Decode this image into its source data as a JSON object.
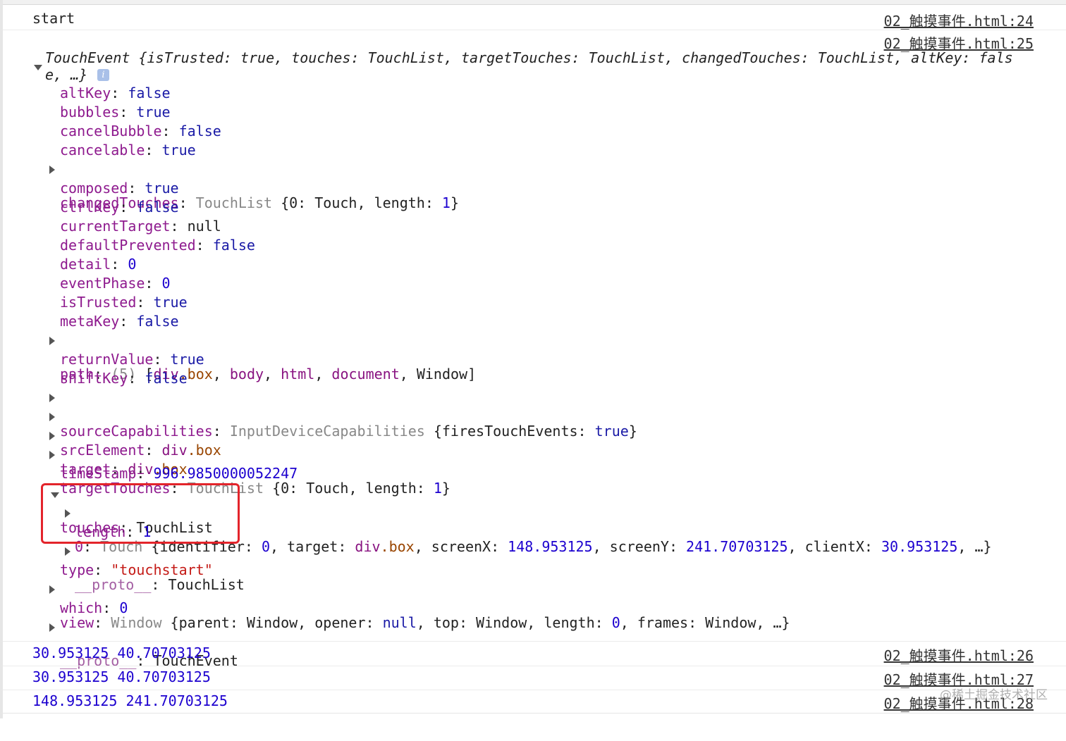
{
  "console": {
    "row_start": {
      "text": "start",
      "src": "02_触摸事件.html:24"
    },
    "event": {
      "src": "02_触摸事件.html:25",
      "summary_line1": "TouchEvent {isTrusted: true, touches: TouchList, targetTouches: TouchList, changedTouches: TouchList, altKey: fals",
      "summary_line2": "e, …}",
      "info_icon": "i",
      "props": {
        "altKey": {
          "key": "altKey",
          "val": "false"
        },
        "bubbles": {
          "key": "bubbles",
          "val": "true"
        },
        "cancelBubble": {
          "key": "cancelBubble",
          "val": "false"
        },
        "cancelable": {
          "key": "cancelable",
          "val": "true"
        },
        "changedTouches": {
          "key": "changedTouches",
          "type": "TouchList",
          "open": "{0: ",
          "mid": "Touch",
          "len_label": ", length: ",
          "len": "1",
          "close": "}"
        },
        "composed": {
          "key": "composed",
          "val": "true"
        },
        "ctrlKey": {
          "key": "ctrlKey",
          "val": "false"
        },
        "currentTarget": {
          "key": "currentTarget",
          "val": "null"
        },
        "defaultPrevented": {
          "key": "defaultPrevented",
          "val": "false"
        },
        "detail": {
          "key": "detail",
          "val": "0"
        },
        "eventPhase": {
          "key": "eventPhase",
          "val": "0"
        },
        "isTrusted": {
          "key": "isTrusted",
          "val": "true"
        },
        "metaKey": {
          "key": "metaKey",
          "val": "false"
        },
        "path": {
          "key": "path",
          "count": "(5)",
          "items": [
            "div",
            ".box",
            "body",
            "html",
            "document",
            "Window"
          ]
        },
        "returnValue": {
          "key": "returnValue",
          "val": "true"
        },
        "shiftKey": {
          "key": "shiftKey",
          "val": "false"
        },
        "sourceCapabilities": {
          "key": "sourceCapabilities",
          "type": "InputDeviceCapabilities",
          "inner_key": "firesTouchEvents",
          "inner_val": "true"
        },
        "srcElement": {
          "key": "srcElement",
          "tag": "div",
          "cls": ".box"
        },
        "target": {
          "key": "target",
          "tag": "div",
          "cls": ".box"
        },
        "targetTouches": {
          "key": "targetTouches",
          "type": "TouchList",
          "open": "{0: ",
          "mid": "Touch",
          "len_label": ", length: ",
          "len": "1",
          "close": "}"
        },
        "timeStamp": {
          "key": "timeStamp",
          "val": "996.9850000052247"
        },
        "touches": {
          "key": "touches",
          "type": "TouchList",
          "item0": {
            "idx": "0",
            "type": "Touch",
            "text1": "{identifier: ",
            "v1": "0",
            "text2": ", target: ",
            "tag": "div",
            "cls": ".box",
            "text3": ", screenX: ",
            "v3": "148.953125",
            "text4": ", screenY: ",
            "v4": "241.70703125",
            "text5": ", clientX: ",
            "v5": "30.953125",
            "tail": ", …}"
          },
          "length_key": "length",
          "length_val": "1",
          "proto_key": "__proto__",
          "proto_val": "TouchList"
        },
        "type": {
          "key": "type",
          "val": "\"touchstart\""
        },
        "view": {
          "key": "view",
          "type": "Window",
          "text": " {parent: Window, opener: ",
          "v_null": "null",
          "text2": ", top: Window, length: ",
          "v_len": "0",
          "text3": ", frames: Window, …}"
        },
        "which": {
          "key": "which",
          "val": "0"
        },
        "proto": {
          "key": "__proto__",
          "val": "TouchEvent"
        }
      }
    },
    "rows": [
      {
        "text": "30.953125 40.70703125",
        "src": "02_触摸事件.html:26"
      },
      {
        "text": "30.953125 40.70703125",
        "src": "02_触摸事件.html:27"
      },
      {
        "text": "148.953125 241.70703125",
        "src": "02_触摸事件.html:28"
      }
    ],
    "watermark": "@稀土掘金技术社区"
  },
  "colors": {
    "key": "#8e1a8e",
    "value": "#1a1aa6",
    "number": "#1c00cf",
    "string": "#c41a16",
    "highlight_border": "#e3242b"
  }
}
